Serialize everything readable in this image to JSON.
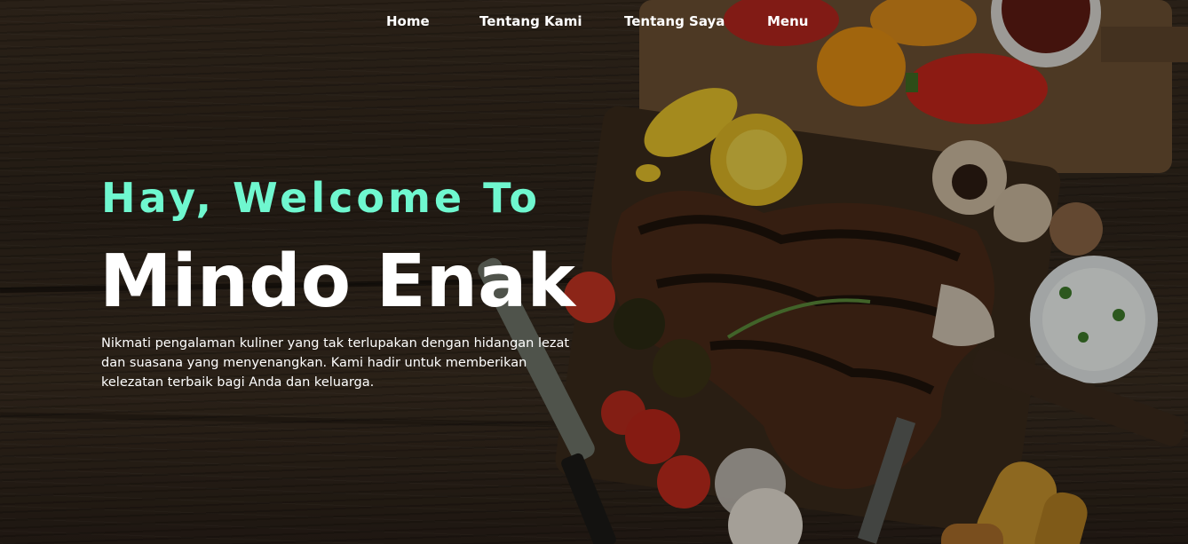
{
  "nav": {
    "items": [
      {
        "label": "Home"
      },
      {
        "label": "Tentang Kami"
      },
      {
        "label": "Tentang Saya"
      },
      {
        "label": "Menu"
      }
    ]
  },
  "hero": {
    "welcome": "Hay, Welcome To",
    "brand": "Mindo Enak",
    "description": "Nikmati pengalaman kuliner yang tak terlupakan dengan hidangan lezat dan suasana yang menyenangkan. Kami hadir untuk memberikan kelezatan terbaik bagi Anda dan keluarga."
  },
  "colors": {
    "accent": "#6ff7cf",
    "text": "#ffffff",
    "wood": "#3a2d20"
  },
  "background": {
    "subject": "grilled-steak-food-photo"
  }
}
